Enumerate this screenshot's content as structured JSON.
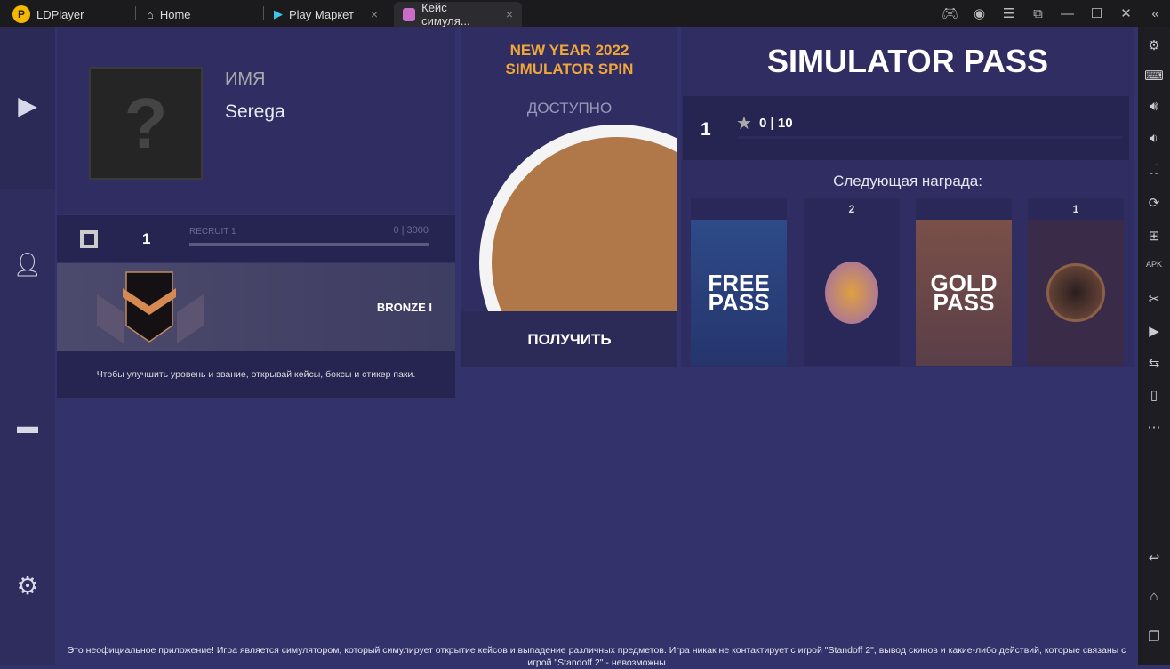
{
  "titlebar": {
    "app_name": "LDPlayer",
    "tabs": [
      {
        "label": "Home",
        "icon": "home-icon"
      },
      {
        "label": "Play Маркет",
        "icon": "play-store-icon"
      },
      {
        "label": "Кейс симуля...",
        "icon": "app-icon"
      }
    ],
    "controls": [
      "gamepad-icon",
      "account-icon",
      "menu-icon",
      "resize-icon",
      "minimize-icon",
      "maximize-icon",
      "close-icon",
      "collapse-icon"
    ]
  },
  "sidebar": {
    "items": [
      "play-icon",
      "profile-icon",
      "gun-icon",
      "settings-icon"
    ]
  },
  "profile": {
    "name_label": "ИМЯ",
    "name": "Serega",
    "avatar": "?",
    "level": "1",
    "rank_progress_label": "RECRUIT 1",
    "xp": "0 | 3000",
    "xp_progress": 0,
    "rank": "BRONZE I",
    "hint": "Чтобы улучшить уровень и звание, открывай кейсы, боксы и стикер паки."
  },
  "spin": {
    "title_line1": "NEW YEAR 2022",
    "title_line2": "SIMULATOR SPIN",
    "status": "ДОСТУПНО",
    "button": "ПОЛУЧИТЬ"
  },
  "pass": {
    "title": "SIMULATOR PASS",
    "level": "1",
    "stars": "0 | 10",
    "progress": 0,
    "next_reward_label": "Следующая награда:",
    "rewards": [
      {
        "count": "",
        "label": "FREE PASS"
      },
      {
        "count": "2",
        "label": ""
      },
      {
        "count": "",
        "label": "GOLD PASS"
      },
      {
        "count": "1",
        "label": ""
      }
    ]
  },
  "footer": "Это неофициальное приложение! Игра является симулятором, который симулирует открытие кейсов и выпадение различных предметов. Игра никак не контактирует с игрой \"Standoff 2\", вывод скинов и какие-либо действий, которые связаны с игрой \"Standoff 2\" - невозможны",
  "colors": {
    "accent_gold": "#f0a63a",
    "background": "#34326a"
  }
}
